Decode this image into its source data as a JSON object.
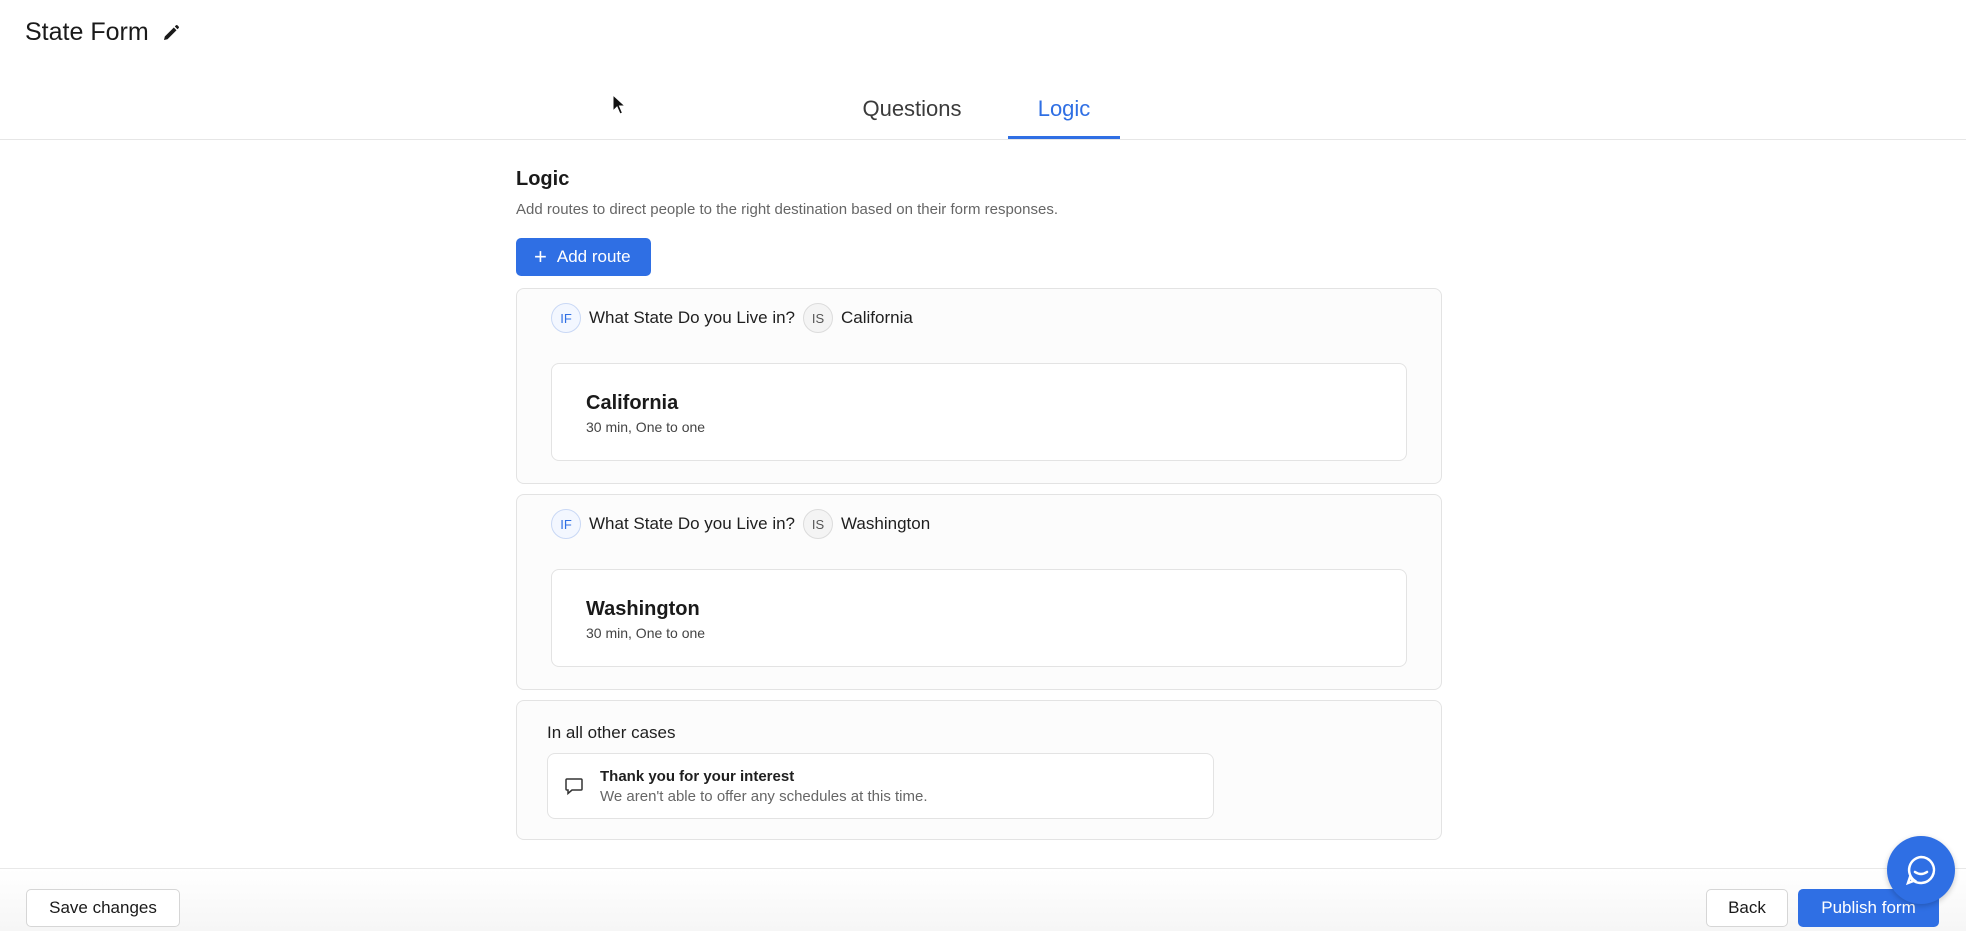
{
  "header": {
    "form_title": "State Form",
    "tabs": [
      {
        "label": "Questions",
        "active": false
      },
      {
        "label": "Logic",
        "active": true
      }
    ]
  },
  "logic": {
    "title": "Logic",
    "description": "Add routes to direct people to the right destination based on their form responses.",
    "add_route_label": "Add route",
    "routes": [
      {
        "if_label": "IF",
        "question": "What State Do you Live in?",
        "is_label": "IS",
        "answer": "California",
        "destination": {
          "name": "California",
          "meta": "30 min, One to one"
        }
      },
      {
        "if_label": "IF",
        "question": "What State Do you Live in?",
        "is_label": "IS",
        "answer": "Washington",
        "destination": {
          "name": "Washington",
          "meta": "30 min, One to one"
        }
      }
    ],
    "fallback": {
      "label": "In all other cases",
      "message_title": "Thank you for your interest",
      "message_subtitle": "We aren't able to offer any schedules at this time."
    }
  },
  "footer": {
    "save_label": "Save changes",
    "back_label": "Back",
    "publish_label": "Publish form"
  },
  "colors": {
    "accent": "#2f6fe4",
    "border": "#e3e3e3"
  },
  "icons": {
    "edit": "pencil-icon",
    "add": "plus-icon",
    "message": "chat-bubble-icon",
    "help": "chat-launcher-icon"
  }
}
